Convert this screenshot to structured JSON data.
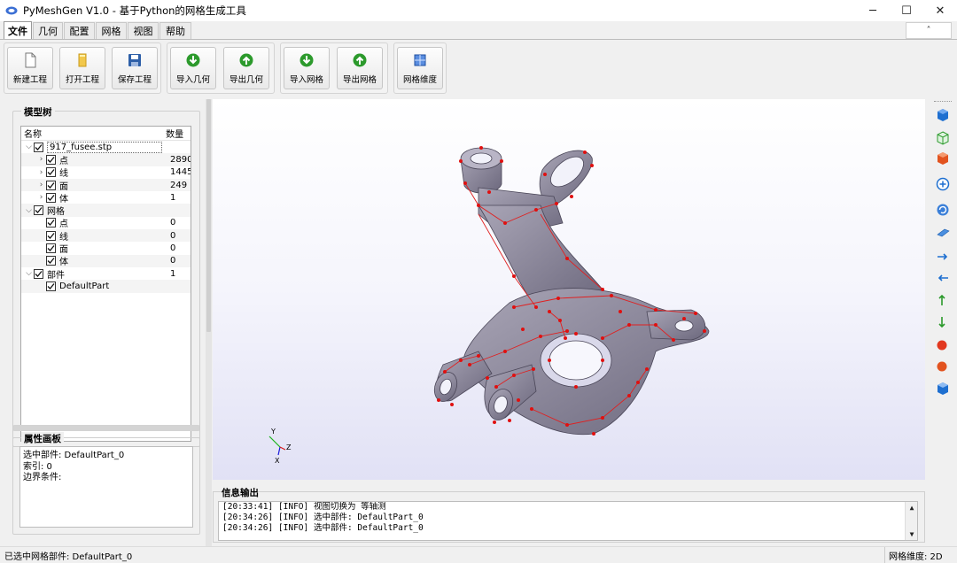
{
  "window": {
    "title": "PyMeshGen V1.0 - 基于Python的网格生成工具",
    "minimize": "─",
    "maximize": "☐",
    "close": "✕"
  },
  "tabs": [
    "文件",
    "几何",
    "配置",
    "网格",
    "视图",
    "帮助"
  ],
  "ribbon_collapse": "˄",
  "ribbon": {
    "new_project": "新建工程",
    "open_project": "打开工程",
    "save_project": "保存工程",
    "import_geometry": "导入几何",
    "export_geometry": "导出几何",
    "import_mesh": "导入网格",
    "export_mesh": "导出网格",
    "mesh_dimension": "网格维度"
  },
  "model_tree": {
    "title": "模型树",
    "header_name": "名称",
    "header_count": "数量",
    "rows": [
      {
        "name": "917_fusee.stp",
        "count": ""
      },
      {
        "name": "点",
        "count": "2890"
      },
      {
        "name": "线",
        "count": "1445"
      },
      {
        "name": "面",
        "count": "249"
      },
      {
        "name": "体",
        "count": "1"
      },
      {
        "name": "网格",
        "count": ""
      },
      {
        "name": "点",
        "count": "0"
      },
      {
        "name": "线",
        "count": "0"
      },
      {
        "name": "面",
        "count": "0"
      },
      {
        "name": "体",
        "count": "0"
      },
      {
        "name": "部件",
        "count": "1"
      },
      {
        "name": "DefaultPart",
        "count": ""
      }
    ]
  },
  "properties": {
    "title": "属性画板",
    "line1": "选中部件: DefaultPart_0",
    "line2": "索引: 0",
    "line3": "边界条件:"
  },
  "axes": {
    "y": "Y",
    "x": "X",
    "z": "Z"
  },
  "info": {
    "title": "信息输出",
    "lines": [
      "[20:33:41] [INFO] 视图切换为 等轴测",
      "[20:34:26] [INFO] 选中部件: DefaultPart_0",
      "[20:34:26] [INFO] 选中部件: DefaultPart_0"
    ]
  },
  "status": {
    "left": "已选中网格部件: DefaultPart_0",
    "right": "网格维度: 2D"
  },
  "colors": {
    "model_fill": "#8e8a9c",
    "point_red": "#e01010",
    "icon_blue": "#1e6fd0",
    "icon_green": "#2c9a2c"
  }
}
